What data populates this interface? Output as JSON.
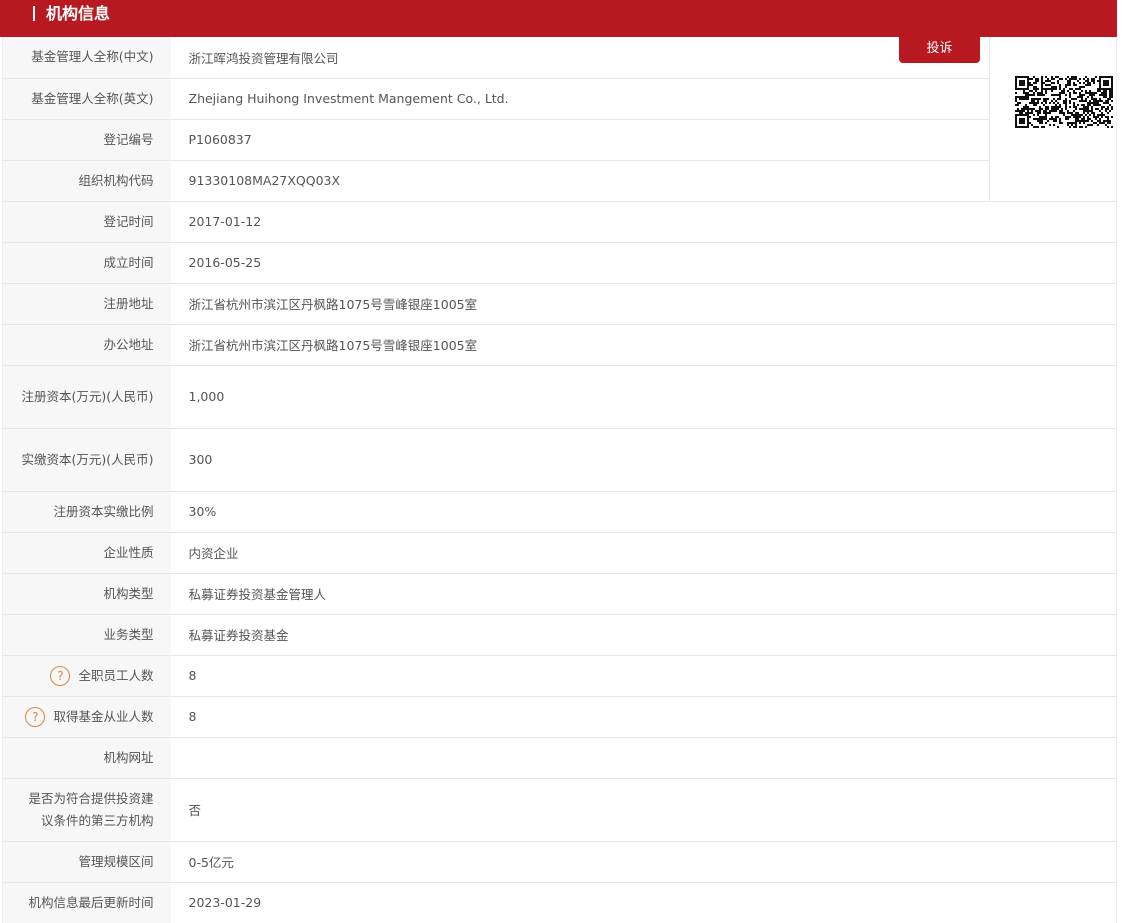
{
  "header": {
    "title": "机构信息"
  },
  "complaint_button_label": "投诉",
  "rows": [
    {
      "label": "基金管理人全称(中文)",
      "value": "浙江晖鸿投资管理有限公司"
    },
    {
      "label": "基金管理人全称(英文)",
      "value": "Zhejiang Huihong Investment Mangement Co., Ltd."
    },
    {
      "label": "登记编号",
      "value": "P1060837"
    },
    {
      "label": "组织机构代码",
      "value": "91330108MA27XQQ03X"
    },
    {
      "label": "登记时间",
      "value": "2017-01-12"
    },
    {
      "label": "成立时间",
      "value": "2016-05-25"
    },
    {
      "label": "注册地址",
      "value": "浙江省杭州市滨江区丹枫路1075号雪峰银座1005室"
    },
    {
      "label": "办公地址",
      "value": "浙江省杭州市滨江区丹枫路1075号雪峰银座1005室"
    },
    {
      "label": "注册资本(万元)(人民币)",
      "value": "1,000"
    },
    {
      "label": "实缴资本(万元)(人民币)",
      "value": "300"
    },
    {
      "label": "注册资本实缴比例",
      "value": "30%"
    },
    {
      "label": "企业性质",
      "value": "内资企业"
    },
    {
      "label": "机构类型",
      "value": "私募证券投资基金管理人"
    },
    {
      "label": "业务类型",
      "value": "私募证券投资基金"
    },
    {
      "label": "全职员工人数",
      "value": "8"
    },
    {
      "label": "取得基金从业人数",
      "value": "8"
    },
    {
      "label": "机构网址",
      "value": ""
    },
    {
      "label": "是否为符合提供投资建议条件的第三方机构",
      "value": "否"
    },
    {
      "label": "管理规模区间",
      "value": "0-5亿元"
    },
    {
      "label": "机构信息最后更新时间",
      "value": "2023-01-29"
    }
  ],
  "icons": {
    "help": "question-circle-icon",
    "qr": "qr-code-icon"
  },
  "colors": {
    "brand_red": "#b81820",
    "help_icon": "#d9883b",
    "label_bg": "#f7f7f7"
  }
}
